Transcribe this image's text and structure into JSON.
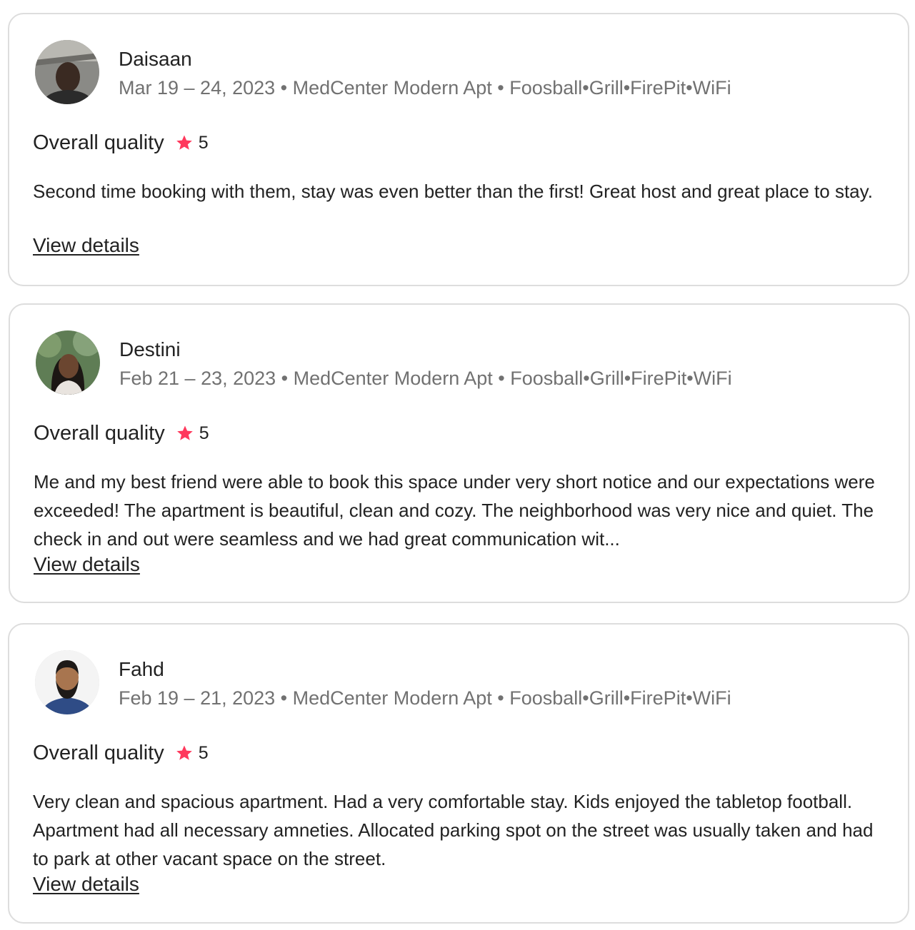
{
  "colors": {
    "star": "#ff385c",
    "muted_text": "#717171",
    "text": "#222222",
    "border": "#dddddd"
  },
  "reviews": [
    {
      "name": "Daisaan",
      "meta": "Mar 19 – 24, 2023 • MedCenter Modern Apt • Foosball•Grill•FirePit•WiFi",
      "rating_label": "Overall quality",
      "rating_icon": "star-icon",
      "rating": "5",
      "text": "Second time booking with them, stay was even better than the first! Great host and great place to stay.",
      "link": "View details"
    },
    {
      "name": "Destini",
      "meta": "Feb 21 – 23, 2023 • MedCenter Modern Apt • Foosball•Grill•FirePit•WiFi",
      "rating_label": "Overall quality",
      "rating_icon": "star-icon",
      "rating": "5",
      "text": "Me and my best friend were able to book this space under very short notice and our expectations were exceeded! The apartment is beautiful, clean and cozy. The neighborhood was very nice and quiet. The check in and out were seamless and we had great communication wit...",
      "link": "View details"
    },
    {
      "name": "Fahd",
      "meta": "Feb 19 – 21, 2023 • MedCenter Modern Apt • Foosball•Grill•FirePit•WiFi",
      "rating_label": "Overall quality",
      "rating_icon": "star-icon",
      "rating": "5",
      "text": "Very clean and spacious apartment. Had a very comfortable stay. Kids enjoyed the tabletop football. Apartment had all necessary amneties. Allocated parking spot on the street was usually taken and had to park at other vacant space on the street.",
      "link": "View details"
    }
  ]
}
